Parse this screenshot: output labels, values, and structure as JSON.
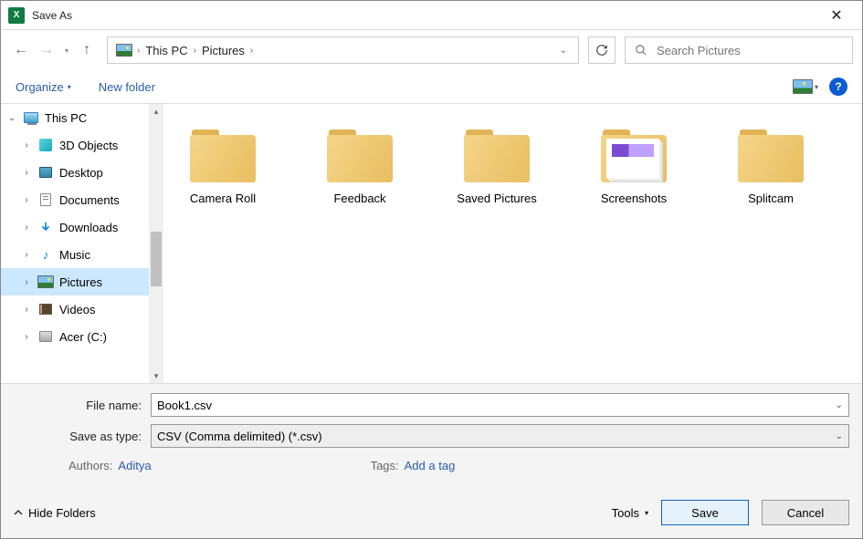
{
  "window": {
    "title": "Save As"
  },
  "breadcrumb": {
    "root": "This PC",
    "current": "Pictures"
  },
  "search": {
    "placeholder": "Search Pictures"
  },
  "cmdbar": {
    "organize": "Organize",
    "newfolder": "New folder"
  },
  "tree": {
    "root": "This PC",
    "items": [
      {
        "label": "3D Objects"
      },
      {
        "label": "Desktop"
      },
      {
        "label": "Documents"
      },
      {
        "label": "Downloads"
      },
      {
        "label": "Music"
      },
      {
        "label": "Pictures"
      },
      {
        "label": "Videos"
      },
      {
        "label": "Acer (C:)"
      }
    ]
  },
  "folders": {
    "f0": "Camera Roll",
    "f1": "Feedback",
    "f2": "Saved Pictures",
    "f3": "Screenshots",
    "f4": "Splitcam"
  },
  "form": {
    "filename_lbl": "File name:",
    "filename_val": "Book1.csv",
    "type_lbl": "Save as type:",
    "type_val": "CSV (Comma delimited) (*.csv)",
    "authors_lbl": "Authors:",
    "authors_val": "Aditya",
    "tags_lbl": "Tags:",
    "tags_val": "Add a tag"
  },
  "actions": {
    "hide_folders": "Hide Folders",
    "tools": "Tools",
    "save": "Save",
    "cancel": "Cancel"
  }
}
